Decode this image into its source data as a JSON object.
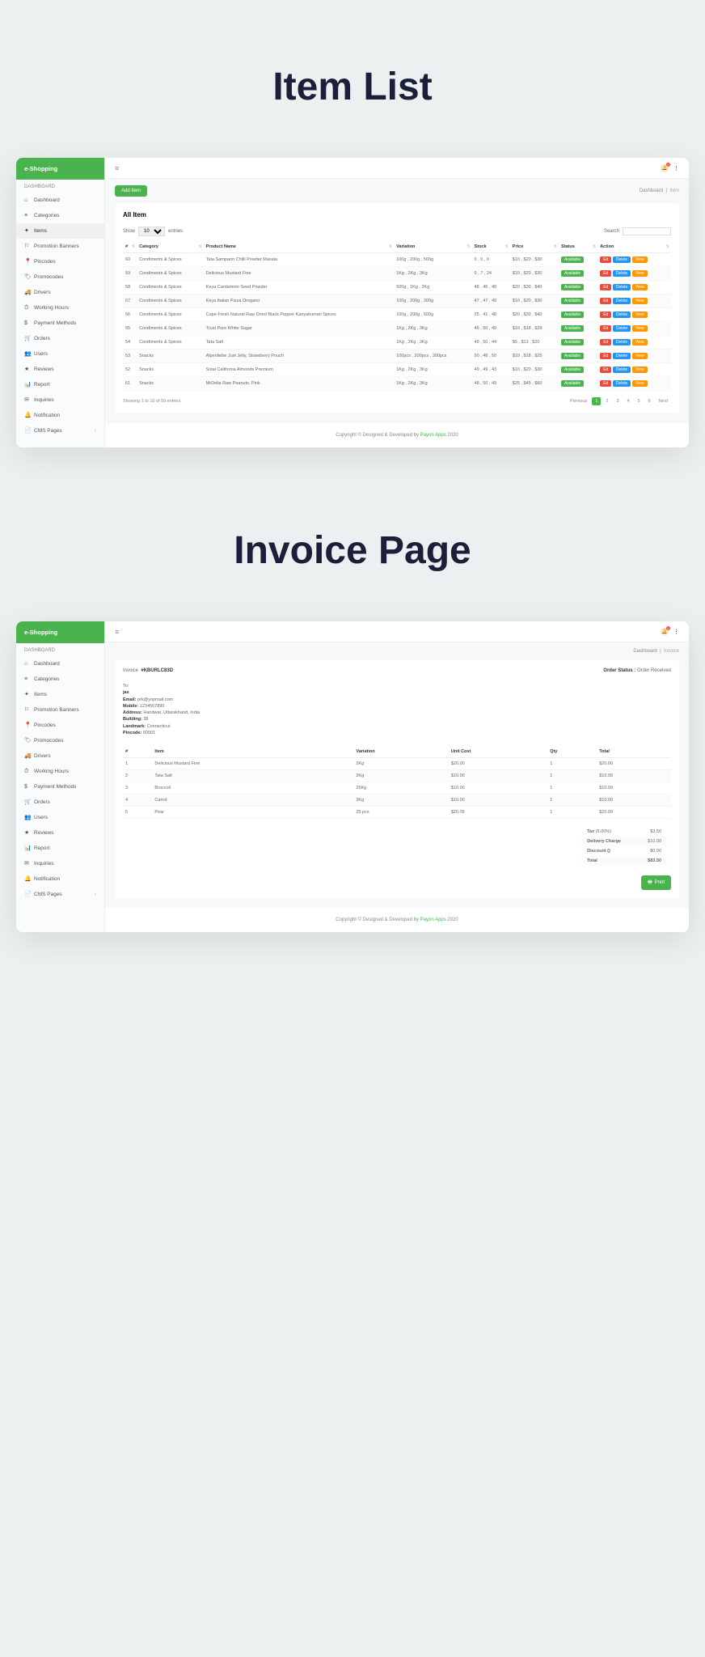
{
  "headings": {
    "item_list": "Item List",
    "invoice_page": "Invoice Page"
  },
  "brand": "e-Shopping",
  "sidebar": {
    "section": "DASHBOARD",
    "items": [
      {
        "icon": "⌂",
        "label": "Dashboard"
      },
      {
        "icon": "≡",
        "label": "Categories"
      },
      {
        "icon": "✦",
        "label": "Items"
      },
      {
        "icon": "⚐",
        "label": "Promotion Banners"
      },
      {
        "icon": "📍",
        "label": "Pincodes"
      },
      {
        "icon": "🏷",
        "label": "Promocodes"
      },
      {
        "icon": "🚚",
        "label": "Drivers"
      },
      {
        "icon": "⏱",
        "label": "Working Hours"
      },
      {
        "icon": "$",
        "label": "Payment Methods"
      },
      {
        "icon": "🛒",
        "label": "Orders"
      },
      {
        "icon": "👥",
        "label": "Users"
      },
      {
        "icon": "★",
        "label": "Reviews"
      },
      {
        "icon": "📊",
        "label": "Report"
      },
      {
        "icon": "✉",
        "label": "Inquiries"
      },
      {
        "icon": "🔔",
        "label": "Notification"
      },
      {
        "icon": "📄",
        "label": "CMS Pages"
      }
    ]
  },
  "notif_count": "2",
  "item_list": {
    "add_btn": "Add Item",
    "breadcrumb": {
      "root": "Dashboard",
      "current": "Item"
    },
    "card_title": "All Item",
    "show_label": "Show",
    "entries_val": "10",
    "entries_label": "entries",
    "search_label": "Search",
    "columns": [
      "#",
      "Category",
      "Product Name",
      "Variation",
      "Stock",
      "Price",
      "Status",
      "Action"
    ],
    "rows": [
      {
        "n": "60",
        "cat": "Condiments & Spices",
        "name": "Tata Sampann Chilli Powder Masala",
        "var": "100g , 200g , 500g",
        "stock": "0 , 0 , 0",
        "price": "$10 , $20 , $30",
        "status": "Available"
      },
      {
        "n": "59",
        "cat": "Condiments & Spices",
        "name": "Delicious Mustard Fine",
        "var": "1Kg , 2Kg , 3Kg",
        "stock": "0 , 7 , 24",
        "price": "$10 , $20 , $30",
        "status": "Available"
      },
      {
        "n": "58",
        "cat": "Condiments & Spices",
        "name": "Keya Cardamom Seed Powder",
        "var": "500g , 1Kg , 2Kg",
        "stock": "48 , 46 , 48",
        "price": "$20 , $30 , $40",
        "status": "Available"
      },
      {
        "n": "57",
        "cat": "Condiments & Spices",
        "name": "Keya Italian Pizza Oregano",
        "var": "100g , 200g , 300g",
        "stock": "47 , 47 , 49",
        "price": "$10 , $20 , $30",
        "status": "Available"
      },
      {
        "n": "56",
        "cat": "Condiments & Spices",
        "name": "Cape Fresh Natural Raw Dried Black Pepper Kanyakumari Spices",
        "var": "100g , 200g , 500g",
        "stock": "25 , 41 , 48",
        "price": "$20 , $30 , $40",
        "status": "Available"
      },
      {
        "n": "55",
        "cat": "Condiments & Spices",
        "name": "Trust Pure White Sugar",
        "var": "1Kg , 2Kg , 3Kg",
        "stock": "46 , 50 , 49",
        "price": "$10 , $18 , $29",
        "status": "Available"
      },
      {
        "n": "54",
        "cat": "Condiments & Spices",
        "name": "Tata Salt",
        "var": "1Kg , 2Kg , 3Kg",
        "stock": "49 , 50 , 44",
        "price": "$5 , $13 , $20",
        "status": "Available"
      },
      {
        "n": "53",
        "cat": "Snacks",
        "name": "Alpenliebe Just Jelly, Strawberry Pouch",
        "var": "100pcs , 200pcs , 300pcs",
        "stock": "50 , 48 , 50",
        "price": "$10 , $18 , $25",
        "status": "Available"
      },
      {
        "n": "52",
        "cat": "Snacks",
        "name": "Solai California Almonds Premium",
        "var": "1Kg , 2Kg , 3Kg",
        "stock": "49 , 49 , 43",
        "price": "$10 , $20 , $30",
        "status": "Available"
      },
      {
        "n": "51",
        "cat": "Snacks",
        "name": "MrDelia Raw Peanuts, Pink",
        "var": "1Kg , 2Kg , 3Kg",
        "stock": "48 , 50 , 49",
        "price": "$25 , $45 , $60",
        "status": "Available"
      }
    ],
    "actions": {
      "edit": "Ed",
      "delete": "Delete",
      "view": "View"
    },
    "info": "Showing 1 to 10 of 59 entries",
    "prev": "Previous",
    "next": "Next",
    "pages": [
      "1",
      "2",
      "3",
      "4",
      "5",
      "6"
    ]
  },
  "invoice": {
    "breadcrumb": {
      "root": "Dashboard",
      "current": "Invoice"
    },
    "inv_label": "Invoice",
    "inv_num": "#KBURLC83D",
    "status_label": "Order Status :",
    "status_val": "Order Received",
    "to_label": "To:",
    "to": {
      "name": "jas",
      "email_l": "Email:",
      "email": "prk@yopmail.com",
      "mobile_l": "Mobile:",
      "mobile": "1234567890",
      "addr_l": "Address:",
      "addr": "Haridwar, Uttarakhand, India",
      "build_l": "Building:",
      "build": "38",
      "land_l": "Landmark:",
      "land": "Connecticut",
      "pin_l": "Pincode:",
      "pin": "90001"
    },
    "columns": [
      "#",
      "Item",
      "Variation",
      "Unit Cost",
      "Qty",
      "Total"
    ],
    "rows": [
      {
        "n": "1",
        "item": "Delicious Mustard Fine",
        "var": "2Kg",
        "cost": "$20.00",
        "qty": "1",
        "total": "$20.00"
      },
      {
        "n": "2",
        "item": "Tata Salt",
        "var": "2Kg",
        "cost": "$10.00",
        "qty": "1",
        "total": "$10.00"
      },
      {
        "n": "3",
        "item": "Broccoli",
        "var": "25Kg",
        "cost": "$10.00",
        "qty": "1",
        "total": "$10.00"
      },
      {
        "n": "4",
        "item": "Carrot",
        "var": "3Kg",
        "cost": "$10.00",
        "qty": "1",
        "total": "$10.00"
      },
      {
        "n": "5",
        "item": "Pear",
        "var": "25 pcs",
        "cost": "$20.09",
        "qty": "1",
        "total": "$20.00"
      }
    ],
    "tax_l": "Tax",
    "tax_pct": "(5.00%)",
    "tax": "$3.50",
    "delivery_l": "Delivery Charge",
    "delivery": "$10.00",
    "discount_l": "Discount ()",
    "discount": "$0.00",
    "total_l": "Total",
    "total": "$83.50",
    "print": "Print"
  },
  "footer": {
    "pre": "Copyright © Designed & Developed by ",
    "link": "Payon Apps",
    "post": " 2020"
  }
}
